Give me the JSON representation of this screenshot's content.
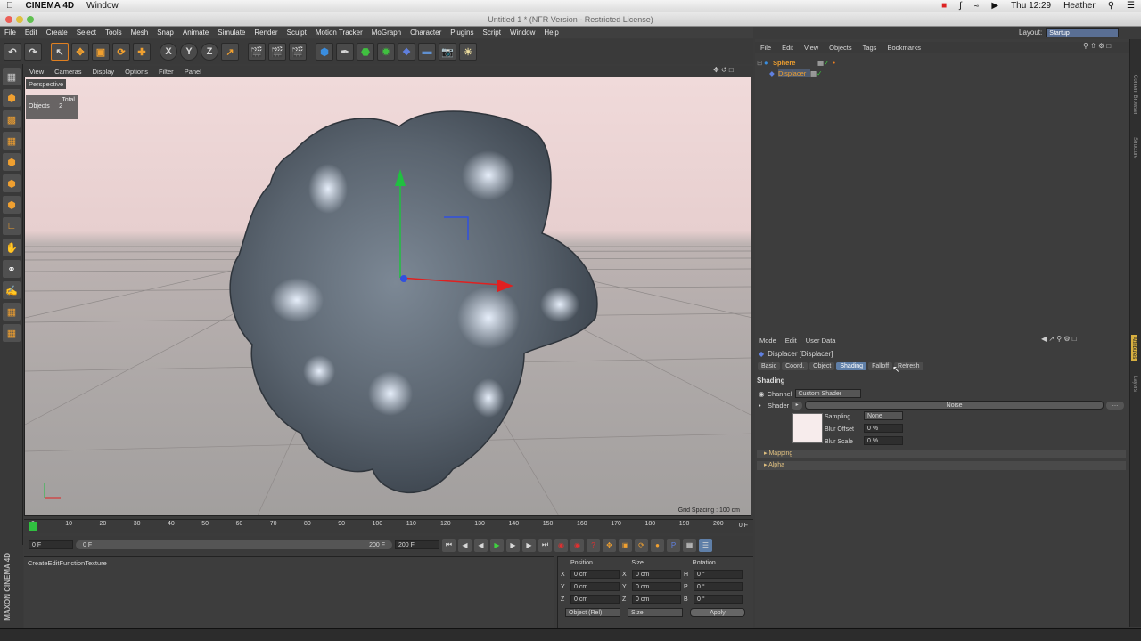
{
  "mac": {
    "app": "CINEMA 4D",
    "menu": "Window",
    "clock": "Thu 12:29",
    "user": "Heather"
  },
  "window_title": "Untitled 1 * (NFR Version - Restricted License)",
  "menubar": [
    "File",
    "Edit",
    "Create",
    "Select",
    "Tools",
    "Mesh",
    "Snap",
    "Animate",
    "Simulate",
    "Render",
    "Sculpt",
    "Motion Tracker",
    "MoGraph",
    "Character",
    "Plugins",
    "Script",
    "Window",
    "Help"
  ],
  "layout": {
    "label": "Layout:",
    "value": "Startup"
  },
  "toolbar_axis": [
    "X",
    "Y",
    "Z"
  ],
  "viewport": {
    "menu": [
      "View",
      "Cameras",
      "Display",
      "Options",
      "Filter",
      "Panel"
    ],
    "name": "Perspective",
    "stats_header": "Total",
    "stats_label": "Objects",
    "stats_value": "2",
    "grid_spacing": "Grid Spacing : 100 cm"
  },
  "object_manager": {
    "menu": [
      "File",
      "Edit",
      "View",
      "Objects",
      "Tags",
      "Bookmarks"
    ],
    "objects": [
      {
        "name": "Sphere"
      },
      {
        "name": "Displacer"
      }
    ]
  },
  "attributes": {
    "menu": [
      "Mode",
      "Edit",
      "User Data"
    ],
    "object_title": "Displacer [Displacer]",
    "tabs": [
      "Basic",
      "Coord.",
      "Object",
      "Shading",
      "Falloff",
      "Refresh"
    ],
    "active_tab": "Shading",
    "section": "Shading",
    "channel_label": "Channel",
    "channel_value": "Custom Shader",
    "shader_label": "Shader",
    "shader_value": "Noise",
    "sampling_label": "Sampling",
    "sampling_value": "None",
    "blur_offset_label": "Blur Offset",
    "blur_offset_value": "0 %",
    "blur_scale_label": "Blur Scale",
    "blur_scale_value": "0 %",
    "sub_sections": [
      "Mapping",
      "Alpha"
    ]
  },
  "side_tabs": [
    "Content Browser",
    "Structure",
    "Attributes",
    "Layers"
  ],
  "timeline": {
    "ticks": [
      "0",
      "10",
      "20",
      "30",
      "40",
      "50",
      "60",
      "70",
      "80",
      "90",
      "100",
      "110",
      "120",
      "130",
      "140",
      "150",
      "160",
      "170",
      "180",
      "190",
      "200"
    ],
    "end_marker": "0 F",
    "current_frame": "0 F",
    "range_start": "0 F",
    "range_end": "200 F",
    "max_frame": "200 F"
  },
  "material_manager": {
    "menu": [
      "Create",
      "Edit",
      "Function",
      "Texture"
    ]
  },
  "coordinates": {
    "headers": [
      "Position",
      "Size",
      "Rotation"
    ],
    "rows": [
      {
        "axis": "X",
        "pos": "0 cm",
        "size_axis": "X",
        "size": "0 cm",
        "rot_axis": "H",
        "rot": "0 °"
      },
      {
        "axis": "Y",
        "pos": "0 cm",
        "size_axis": "Y",
        "size": "0 cm",
        "rot_axis": "P",
        "rot": "0 °"
      },
      {
        "axis": "Z",
        "pos": "0 cm",
        "size_axis": "Z",
        "size": "0 cm",
        "rot_axis": "B",
        "rot": "0 °"
      }
    ],
    "mode": "Object (Rel)",
    "size_mode": "Size",
    "apply": "Apply"
  },
  "brand": "MAXON CINEMA 4D",
  "colors": {
    "accent": "#5f7fa8",
    "object_name": "#f0a030",
    "x_axis": "#e02020",
    "y_axis": "#20c040",
    "z_axis": "#3050e0"
  }
}
